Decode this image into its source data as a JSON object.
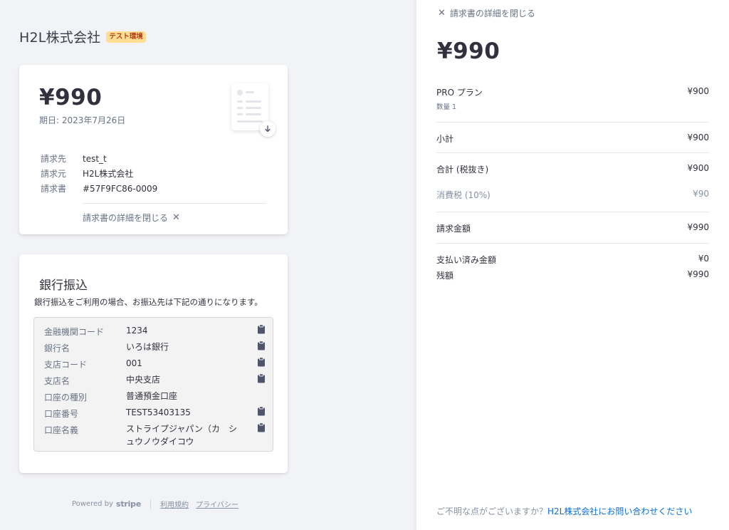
{
  "header": {
    "company_name": "H2L株式会社",
    "test_badge": "テスト環境"
  },
  "invoice_card": {
    "amount": "¥990",
    "due_date": "期日: 2023年7月26日",
    "meta": [
      {
        "key": "請求先",
        "value": "test_t"
      },
      {
        "key": "請求元",
        "value": "H2L株式会社"
      },
      {
        "key": "請求書",
        "value": "#57F9FC86-0009"
      }
    ],
    "close_details_label": "請求書の詳細を閉じる",
    "close_icon": "close-icon",
    "download_icon": "download-icon"
  },
  "bank_transfer": {
    "title": "銀行振込",
    "description": "銀行振込をご利用の場合、お振込先は下記の通りになります。",
    "rows": [
      {
        "key": "金融機関コード",
        "value": "1234",
        "copy": true
      },
      {
        "key": "銀行名",
        "value": "いろは銀行",
        "copy": true
      },
      {
        "key": "支店コード",
        "value": "001",
        "copy": true
      },
      {
        "key": "支店名",
        "value": "中央支店",
        "copy": true
      },
      {
        "key": "口座の種別",
        "value": "普通預金口座",
        "copy": false
      },
      {
        "key": "口座番号",
        "value": "TEST53403135",
        "copy": true
      },
      {
        "key": "口座名義",
        "value": "ストライプジャパン（カ　シュウノウダイコウ",
        "copy": true
      }
    ],
    "copy_icon": "clipboard-icon"
  },
  "footer": {
    "powered_by": "Powered by",
    "brand": "stripe",
    "terms": "利用規約",
    "privacy": "プライバシー"
  },
  "panel": {
    "close_label": "請求書の詳細を閉じる",
    "amount": "¥990",
    "item_name": "PRO プラン",
    "item_price": "¥900",
    "item_qty": "数量 1",
    "subtotal_label": "小計",
    "subtotal_value": "¥900",
    "total_excl_label": "合計 (税抜き)",
    "total_excl_value": "¥900",
    "tax_label": "消費税 (10%)",
    "tax_value": "¥90",
    "billed_label": "請求金額",
    "billed_value": "¥990",
    "paid_label": "支払い済み金額",
    "paid_value": "¥0",
    "balance_label": "残額",
    "balance_value": "¥990",
    "footer_question": "ご不明な点がございますか？",
    "footer_contact": "H2L株式会社にお問い合わせください"
  },
  "colors": {
    "link": "#0d6fd6",
    "badge_bg": "#ffde92",
    "badge_text": "#b3401b"
  }
}
